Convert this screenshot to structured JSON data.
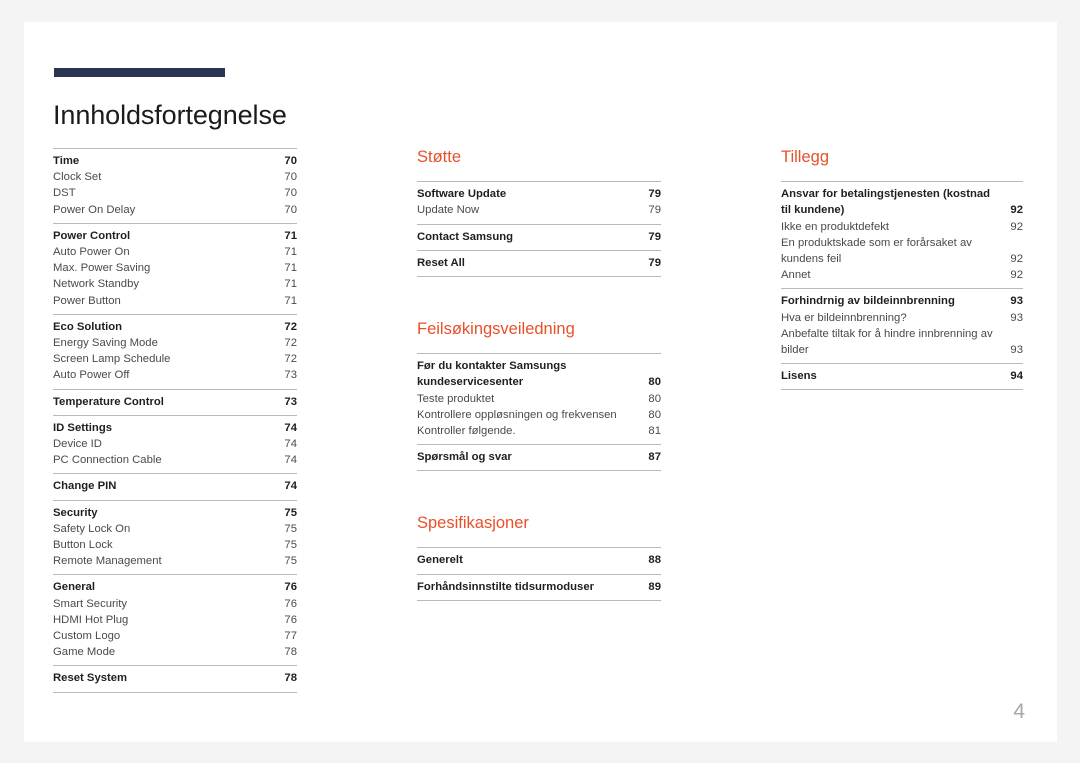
{
  "document": {
    "title": "Innholdsfortegnelse",
    "folio": "4",
    "accent_color": "#e8502a",
    "title_rule_color": "#2b3553"
  },
  "columns": [
    {
      "heading": null,
      "groups": [
        {
          "entries": [
            {
              "label": "Time",
              "page": "70",
              "level": "head"
            },
            {
              "label": "Clock Set",
              "page": "70",
              "level": "sub"
            },
            {
              "label": "DST",
              "page": "70",
              "level": "sub"
            },
            {
              "label": "Power On Delay",
              "page": "70",
              "level": "sub"
            }
          ]
        },
        {
          "entries": [
            {
              "label": "Power Control",
              "page": "71",
              "level": "head"
            },
            {
              "label": "Auto Power On",
              "page": "71",
              "level": "sub"
            },
            {
              "label": "Max. Power Saving",
              "page": "71",
              "level": "sub"
            },
            {
              "label": "Network Standby",
              "page": "71",
              "level": "sub"
            },
            {
              "label": "Power Button",
              "page": "71",
              "level": "sub"
            }
          ]
        },
        {
          "entries": [
            {
              "label": "Eco Solution",
              "page": "72",
              "level": "head"
            },
            {
              "label": "Energy Saving Mode",
              "page": "72",
              "level": "sub"
            },
            {
              "label": "Screen Lamp Schedule",
              "page": "72",
              "level": "sub"
            },
            {
              "label": "Auto Power Off",
              "page": "73",
              "level": "sub"
            }
          ]
        },
        {
          "entries": [
            {
              "label": "Temperature Control",
              "page": "73",
              "level": "head"
            }
          ]
        },
        {
          "entries": [
            {
              "label": "ID Settings",
              "page": "74",
              "level": "head"
            },
            {
              "label": "Device ID",
              "page": "74",
              "level": "sub"
            },
            {
              "label": "PC Connection Cable",
              "page": "74",
              "level": "sub"
            }
          ]
        },
        {
          "entries": [
            {
              "label": "Change PIN",
              "page": "74",
              "level": "head"
            }
          ]
        },
        {
          "entries": [
            {
              "label": "Security",
              "page": "75",
              "level": "head"
            },
            {
              "label": "Safety Lock On",
              "page": "75",
              "level": "sub"
            },
            {
              "label": "Button Lock",
              "page": "75",
              "level": "sub"
            },
            {
              "label": "Remote Management",
              "page": "75",
              "level": "sub"
            }
          ]
        },
        {
          "entries": [
            {
              "label": "General",
              "page": "76",
              "level": "head"
            },
            {
              "label": "Smart Security",
              "page": "76",
              "level": "sub"
            },
            {
              "label": "HDMI Hot Plug",
              "page": "76",
              "level": "sub"
            },
            {
              "label": "Custom Logo",
              "page": "77",
              "level": "sub"
            },
            {
              "label": "Game Mode",
              "page": "78",
              "level": "sub"
            }
          ]
        },
        {
          "last_rule": true,
          "entries": [
            {
              "label": "Reset System",
              "page": "78",
              "level": "head"
            }
          ]
        }
      ]
    },
    {
      "sections": [
        {
          "heading": "Støtte",
          "groups": [
            {
              "entries": [
                {
                  "label": "Software Update",
                  "page": "79",
                  "level": "head"
                },
                {
                  "label": "Update Now",
                  "page": "79",
                  "level": "sub"
                }
              ]
            },
            {
              "entries": [
                {
                  "label": "Contact Samsung",
                  "page": "79",
                  "level": "head"
                }
              ]
            },
            {
              "last_rule": true,
              "entries": [
                {
                  "label": "Reset All",
                  "page": "79",
                  "level": "head"
                }
              ]
            }
          ]
        },
        {
          "heading": "Feilsøkingsveiledning",
          "groups": [
            {
              "entries": [
                {
                  "label": "Før du kontakter Samsungs kundeservicesenter",
                  "page": "80",
                  "level": "head",
                  "wrap": true
                },
                {
                  "label": "Teste produktet",
                  "page": "80",
                  "level": "sub"
                },
                {
                  "label": "Kontrollere oppløsningen og frekvensen",
                  "page": "80",
                  "level": "sub"
                },
                {
                  "label": "Kontroller følgende.",
                  "page": "81",
                  "level": "sub"
                }
              ]
            },
            {
              "last_rule": true,
              "entries": [
                {
                  "label": "Spørsmål og svar",
                  "page": "87",
                  "level": "head"
                }
              ]
            }
          ]
        },
        {
          "heading": "Spesifikasjoner",
          "groups": [
            {
              "entries": [
                {
                  "label": "Generelt",
                  "page": "88",
                  "level": "head"
                }
              ]
            },
            {
              "last_rule": true,
              "entries": [
                {
                  "label": "Forhåndsinnstilte tidsurmoduser",
                  "page": "89",
                  "level": "head"
                }
              ]
            }
          ]
        }
      ]
    },
    {
      "sections": [
        {
          "heading": "Tillegg",
          "groups": [
            {
              "entries": [
                {
                  "label": "Ansvar for betalingstjenesten (kostnad til kundene)",
                  "page": "92",
                  "level": "head",
                  "wrap": true
                },
                {
                  "label": "Ikke en produktdefekt",
                  "page": "92",
                  "level": "sub"
                },
                {
                  "label": "En produktskade som er forårsaket av kundens feil",
                  "page": "92",
                  "level": "sub",
                  "wrap": true
                },
                {
                  "label": "Annet",
                  "page": "92",
                  "level": "sub"
                }
              ]
            },
            {
              "entries": [
                {
                  "label": "Forhindrnig av bildeinnbrenning",
                  "page": "93",
                  "level": "head"
                },
                {
                  "label": "Hva er bildeinnbrenning?",
                  "page": "93",
                  "level": "sub"
                },
                {
                  "label": "Anbefalte tiltak for å hindre innbrenning av bilder",
                  "page": "93",
                  "level": "sub",
                  "wrap": true
                }
              ]
            },
            {
              "last_rule": true,
              "entries": [
                {
                  "label": "Lisens",
                  "page": "94",
                  "level": "head"
                }
              ]
            }
          ]
        }
      ]
    }
  ]
}
